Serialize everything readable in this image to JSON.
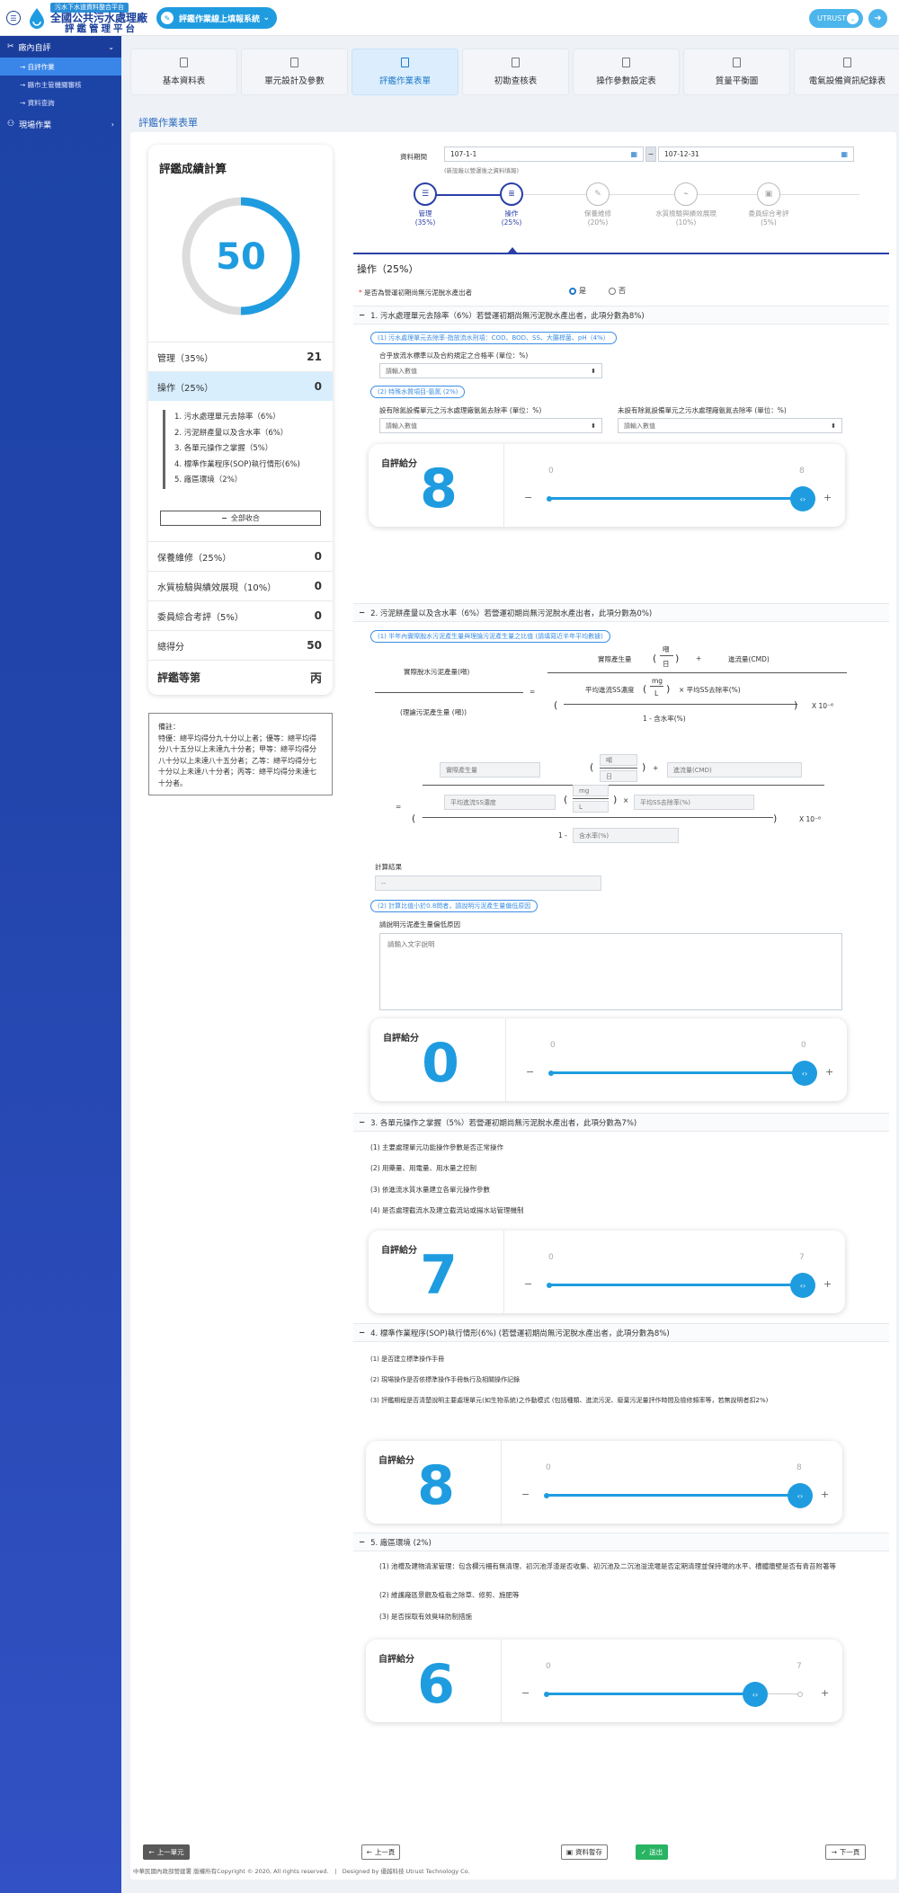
{
  "header": {
    "logo_small": "污水下水道資料整合平台",
    "logo_main": "全國公共污水處理廠",
    "logo_sub": "評鑑管理平台",
    "system_select": "評鑑作業線上填報系統",
    "user": "UTRUST"
  },
  "sidebar": {
    "group1": "廠內自評",
    "items": [
      "自評作業",
      "縣市主管機關審核",
      "資料查詢"
    ],
    "group2": "現場作業"
  },
  "tabs": [
    "基本資料表",
    "單元設計及參數",
    "評鑑作業表單",
    "初勘查核表",
    "操作參數設定表",
    "質量平衡圖",
    "電氣設備資訊紀錄表"
  ],
  "page_title": "評鑑作業表單",
  "score_card": {
    "title": "評鑑成績計算",
    "total_ring": "50",
    "rows": [
      {
        "label": "管理（35%）",
        "value": "21"
      },
      {
        "label": "操作（25%）",
        "value": "0"
      }
    ],
    "sub_items": [
      "1. 污水處理單元去除率（6%）",
      "2. 污泥餅產量以及含水率（6%）",
      "3. 各單元操作之掌握（5%）",
      "4. 標準作業程序(SOP)執行情形(6%)",
      "5. 廠區環境（2%）"
    ],
    "collapse_label": "全部收合",
    "rows2": [
      {
        "label": "保養維修（25%）",
        "value": "0"
      },
      {
        "label": "水質檢驗與績效展現（10%）",
        "value": "0"
      },
      {
        "label": "委員綜合考評（5%）",
        "value": "0"
      },
      {
        "label": "總得分",
        "value": "50"
      },
      {
        "label": "評鑑等第",
        "value": "丙"
      }
    ]
  },
  "note": {
    "title": "備註：",
    "text": "特優：總平均得分九十分以上者；優等：總平均得分八十五分以上未達九十分者；甲等：總平均得分八十分以上未達八十五分者；乙等：總平均得分七十分以上未達八十分者；丙等：總平均得分未達七十分者。"
  },
  "date": {
    "label": "資料期間",
    "start": "107-1-1",
    "end": "107-12-31",
    "note": "(新設廠以營運後之資料填報)"
  },
  "steps": [
    {
      "label": "管理",
      "pct": "(35%)",
      "icon": "☰"
    },
    {
      "label": "操作",
      "pct": "(25%)",
      "icon": "≣"
    },
    {
      "label": "保養維修",
      "pct": "(20%)",
      "icon": "✎"
    },
    {
      "label": "水質檢驗與績效展現",
      "pct": "(10%)",
      "icon": "⌁"
    },
    {
      "label": "委員綜合考評",
      "pct": "(5%)",
      "icon": "▣"
    }
  ],
  "section_title": "操作（25%）",
  "question": {
    "label": "是否為營運初期尚無污泥脫水產出者",
    "yes": "是",
    "no": "否"
  },
  "item1": {
    "title": "1. 污水處理單元去除率（6%）若營運初期尚無污泥脫水產出者，此項分數為8%)",
    "pill1": "(1) 污水處理單元去除率-指放流水刑項：COD、BOD、SS、大腸桿菌、pH（4%）",
    "field1_label": "合乎放流水標準以及合約規定之合格率 (單位：%)",
    "placeholder": "請輸入數值",
    "pill2": "(2) 特殊水質項目-氨氮 (2%)",
    "field2_label": "設有除氮設備單元之污水處理廠氨氮去除率 (單位：%)",
    "field3_label": "未設有除氮設備單元之污水處理廠氨氮去除率 (單位：%)",
    "score_label": "自評給分",
    "score": "8",
    "min": "0",
    "max": "8"
  },
  "item2": {
    "title": "2. 污泥餅產量以及含水率（6%）若營運初期尚無污泥脫水產出者，此項分數為0%)",
    "pill1": "(1) 半年內實際脫水污泥產生量與理論污泥產生量之比值 (請填寫近半年平均數據)",
    "f_actual": "實際脫水污泥產量(噸)",
    "f_theory": "(理論污泥產生量 (噸))",
    "f_prod": "實際產生量",
    "f_ton": "噸",
    "f_day": "日",
    "f_flow": "進流量(CMD)",
    "f_ss": "平均進流SS濃度",
    "f_mg": "mg",
    "f_l": "L",
    "f_ssrate": "× 平均SS去除率(%)",
    "f_one": "1 - 含水率(%)",
    "f_exp": "X 10⁻⁶",
    "f_exp2": "X 10⁻⁶",
    "in_prod": "實際產生量",
    "in_ton": "噸",
    "in_day": "日",
    "in_flow": "進流量(CMD)",
    "in_ss": "平均進流SS濃度",
    "in_mg": "mg",
    "in_l": "L",
    "in_ssrate": "平均SS去除率(%)",
    "in_water": "含水率(%)",
    "calc_label": "計算結果",
    "calc_value": "--",
    "pill2": "(2) 計算比值小於0.8問者，請說明污泥產生量偏低原因",
    "reason_label": "請說明污泥產生量偏低原因",
    "reason_placeholder": "請輸入文字說明",
    "score_label": "自評給分",
    "score": "0",
    "min": "0",
    "max": "0"
  },
  "item3": {
    "title": "3. 各單元操作之掌握（5%）若營運初期尚無污泥脫水產出者，此項分數為7%)",
    "subs": [
      "(1) 主要處理單元功能操作參數是否正常操作",
      "(2) 用藥量、用電量、用水量之控制",
      "(3) 依進流水質水量建立各單元操作參數",
      "(4) 是否處理截流水及建立截流站或揚水站管理機制"
    ],
    "score_label": "自評給分",
    "score": "7",
    "min": "0",
    "max": "7"
  },
  "item4": {
    "title": "4. 標準作業程序(SOP)執行情形(6%) (若營運初期尚無污泥脫水產出者，此項分數為8%)",
    "subs": [
      "(1) 是否建立標準操作手冊",
      "(2) 現場操作是否依標準操作手冊執行及相關操作記錄",
      "(3) 評鑑期程是否清楚說明主要處理單元(如生物系統)之作動模式 (包括種類、進流污泥、廢棄污泥量評作時間及檢修頻率等，若無說明者扣2%)"
    ],
    "score_label": "自評給分",
    "score": "8",
    "min": "0",
    "max": "8"
  },
  "item5": {
    "title": "5. 廠區環境 (2%)",
    "subs": [
      "(1) 池槽及建物清潔管理：包含欄污柵有無清理、初沉池浮渣是否收集、初沉池及二沉池溢流堰是否定期清理並保持堰的水平、槽體牆壁是否有青苔附著等",
      "(2) 維護廠區景觀及植栽之除草、修剪、施肥等",
      "(3) 是否採取有效臭味防制措施"
    ],
    "score_label": "自評給分",
    "score": "6",
    "min": "0",
    "max": "7"
  },
  "bottom": {
    "prev_unit": "上一單元",
    "prev_page": "上一頁",
    "save": "資料暫存",
    "submit": "送出",
    "next_page": "下一頁"
  },
  "footer": "中華民國內政部營建署 版權所有Copyright © 2020, All rights reserved.　|　Designed by 優越科技 Utrust Technology Co."
}
